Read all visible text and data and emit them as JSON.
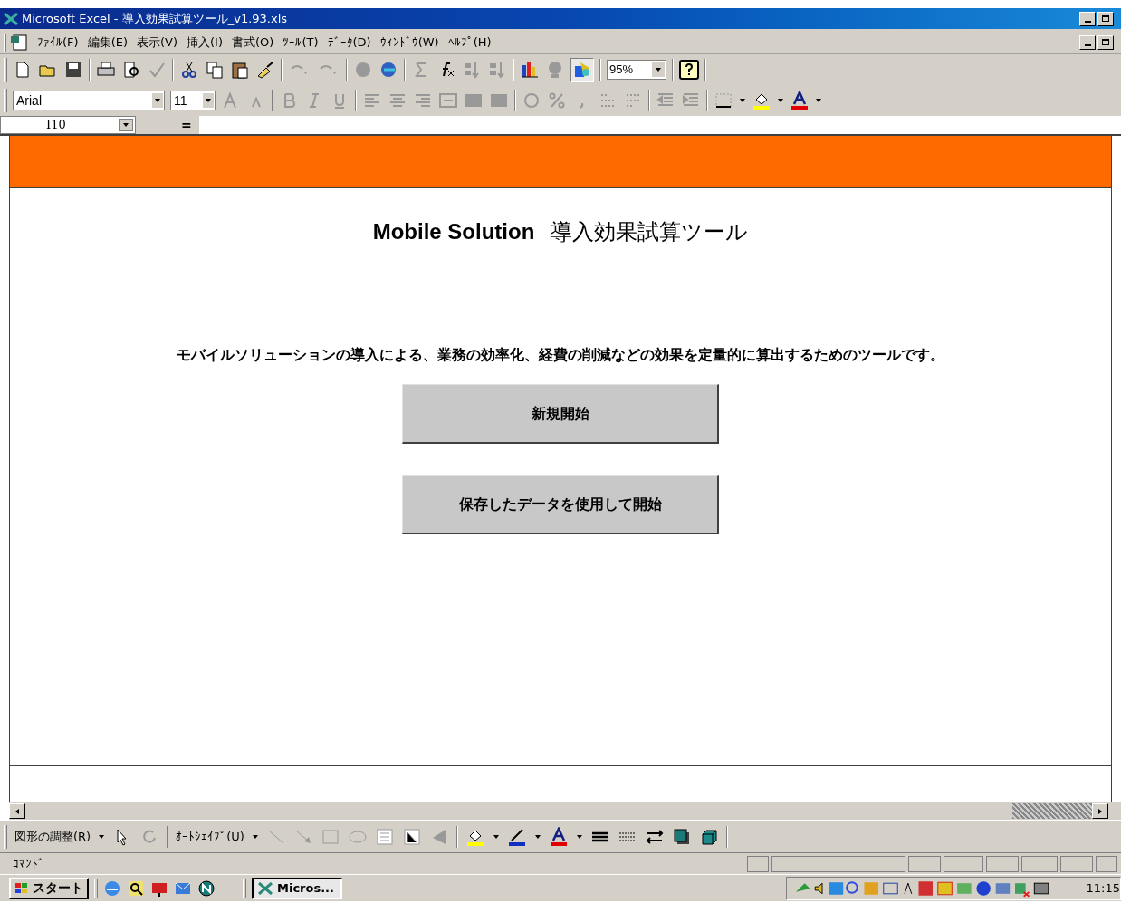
{
  "window": {
    "title": "Microsoft Excel - 導入効果試算ツール_v1.93.xls"
  },
  "menu_bar": {
    "items": [
      "ﾌｧｲﾙ(F)",
      "編集(E)",
      "表示(V)",
      "挿入(I)",
      "書式(O)",
      "ﾂｰﾙ(T)",
      "ﾃﾞｰﾀ(D)",
      "ｳｨﾝﾄﾞｳ(W)",
      "ﾍﾙﾌﾟ(H)"
    ]
  },
  "standard_toolbar": {
    "zoom": "95%"
  },
  "formatting_toolbar": {
    "font": "Arial",
    "font_size": "11"
  },
  "formula_bar": {
    "name_box": "I10",
    "equals": "="
  },
  "sheet": {
    "title_en": "Mobile Solution",
    "title_ja": "導入効果試算ツール",
    "description": "モバイルソリューションの導入による、業務の効率化、経費の削減などの効果を定量的に算出するためのツールです。",
    "buttons": [
      "新規開始",
      "保存したデータを使用して開始"
    ]
  },
  "drawing_toolbar": {
    "items": [
      "図形の調整(R)",
      "ｵｰﾄｼｪｲﾌﾟ(U)"
    ]
  },
  "status_bar": {
    "text": "ｺﾏﾝﾄﾞ"
  },
  "taskbar": {
    "start": "スタート",
    "windows": [
      "Micros..."
    ],
    "clock": "11:15"
  }
}
